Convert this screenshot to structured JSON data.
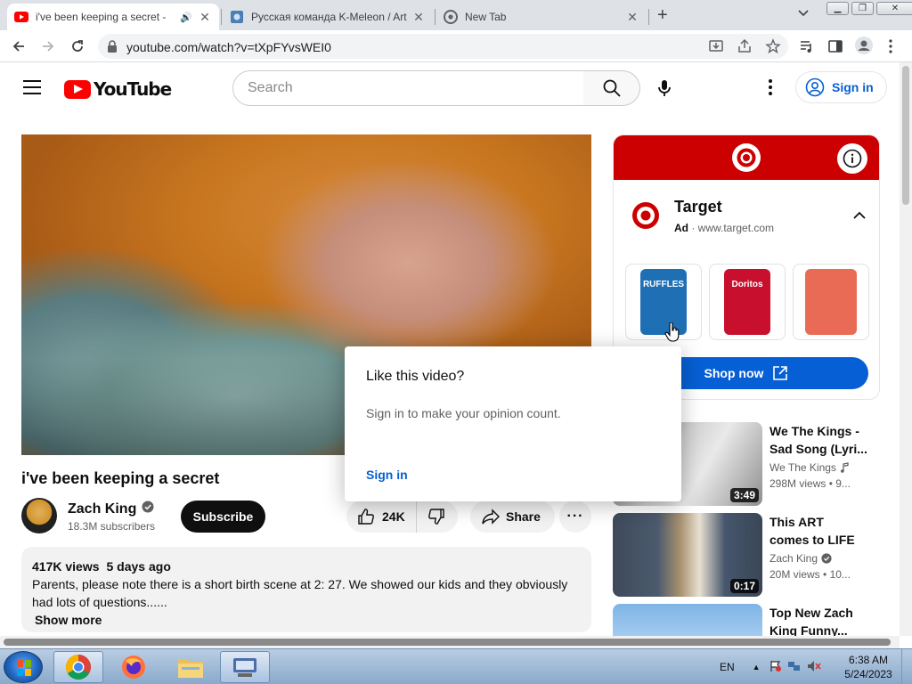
{
  "browser": {
    "tabs": [
      {
        "title": "i've been keeping a secret -",
        "active": true
      },
      {
        "title": "Русская команда K-Meleon / Art",
        "active": false
      },
      {
        "title": "New Tab",
        "active": false
      }
    ],
    "url": "youtube.com/watch?v=tXpFYvsWEI0"
  },
  "header": {
    "logo_text": "YouTube",
    "search_placeholder": "Search",
    "sign_in": "Sign in"
  },
  "video": {
    "title": "i've been keeping a secret",
    "channel": "Zach King",
    "subscribers": "18.3M subscribers",
    "subscribe_label": "Subscribe",
    "likes": "24K",
    "share_label": "Share",
    "more_label": "···",
    "views": "417K views",
    "age": "5 days ago",
    "description": "Parents, please note there is a short birth scene at 2: 27. We showed our kids and they obviously had lots of questions......",
    "show_more": "Show more"
  },
  "ad": {
    "brand": "Target",
    "ad_label": "Ad",
    "domain": "· www.target.com",
    "cta": "Shop now",
    "products": [
      {
        "name": "RUFFLES",
        "color": "#1f6fb5"
      },
      {
        "name": "Doritos",
        "color": "#c8102e"
      },
      {
        "name": "",
        "color": "#e96b55"
      }
    ]
  },
  "popup": {
    "heading": "Like this video?",
    "body": "Sign in to make your opinion count.",
    "action": "Sign in"
  },
  "recommendations": [
    {
      "title1": "We The Kings -",
      "title2": "Sad Song (Lyri...",
      "channel": "We The Kings",
      "views": "298M views",
      "age": "• 9...",
      "duration": "3:49"
    },
    {
      "title1": "This ART",
      "title2": "comes to LIFE",
      "channel": "Zach King",
      "views": "20M views",
      "age": "• 10...",
      "duration": "0:17"
    },
    {
      "title1": "Top New Zach",
      "title2": "King Funny...",
      "channel": "",
      "views": "",
      "age": "",
      "duration": ""
    }
  ],
  "taskbar": {
    "language": "EN",
    "time": "6:38 AM",
    "date": "5/24/2023"
  },
  "colors": {
    "youtube_red": "#ff0000",
    "target_red": "#cc0000",
    "link_blue": "#065fd4"
  }
}
